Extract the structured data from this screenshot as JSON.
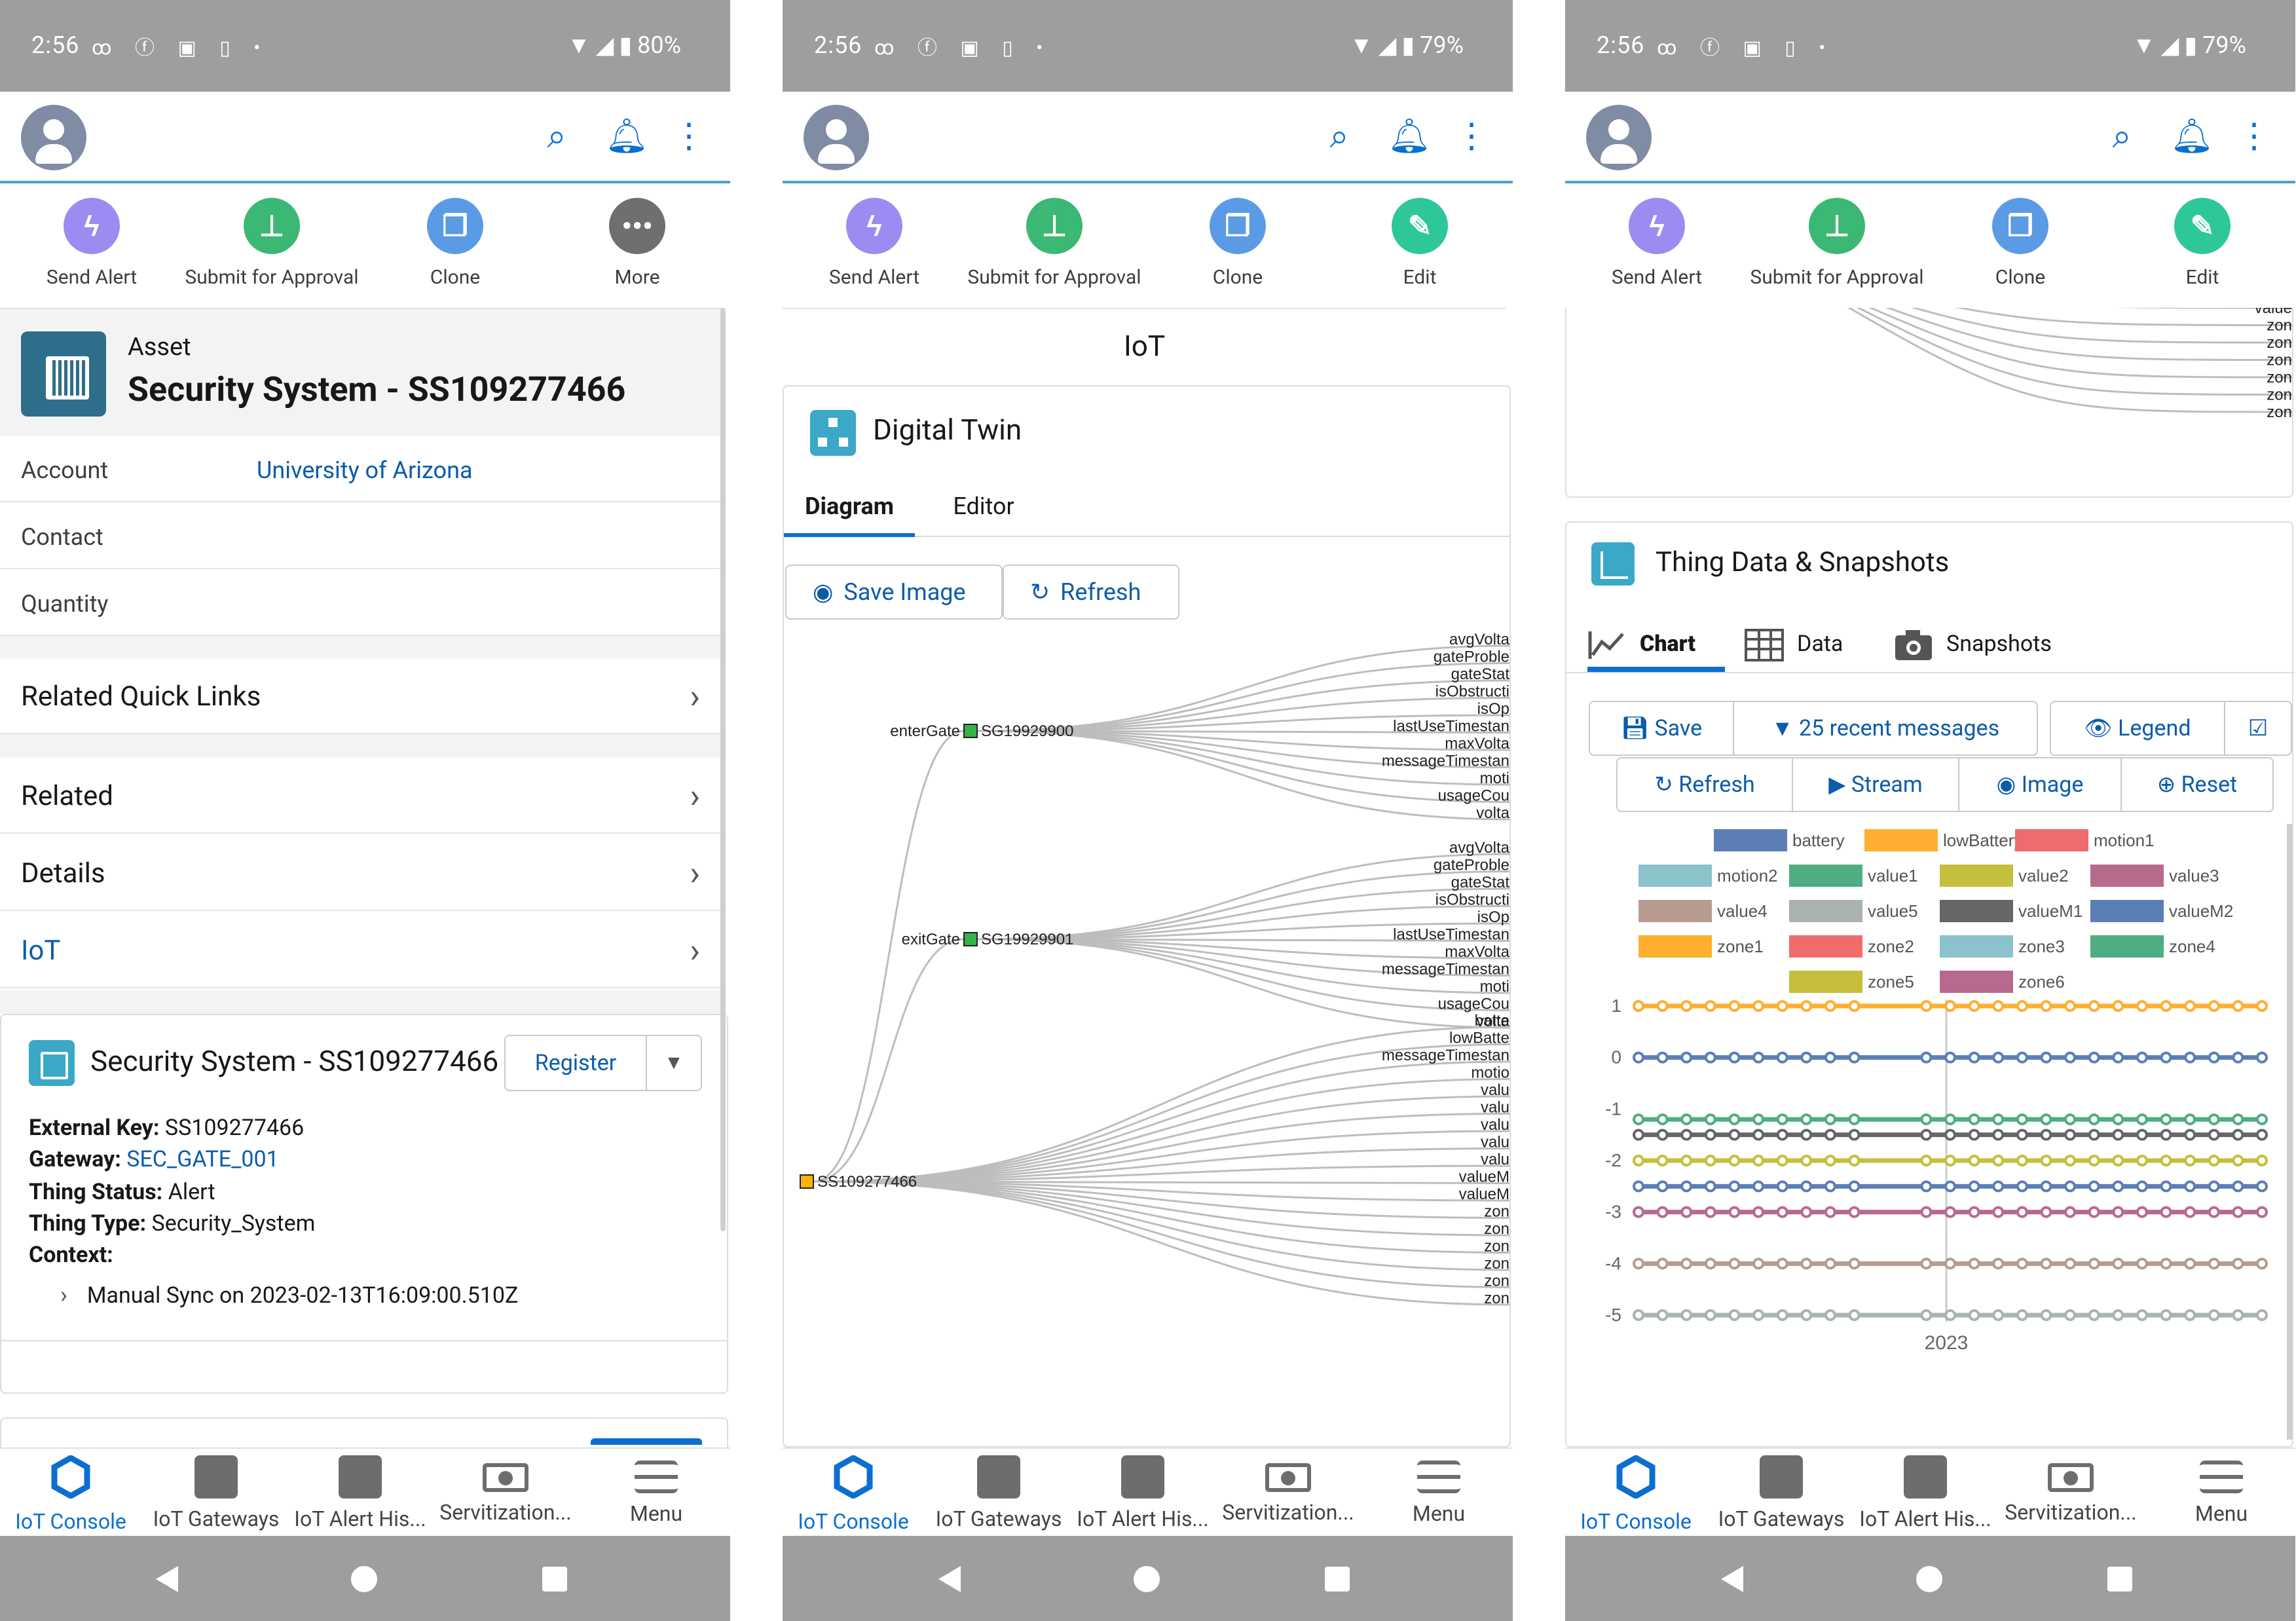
{
  "statusbar": [
    {
      "time": "2:56",
      "battery": "80%"
    },
    {
      "time": "2:56",
      "battery": "79%"
    },
    {
      "time": "2:56",
      "battery": "79%"
    }
  ],
  "actions_s1": [
    "Send Alert",
    "Submit for Approval",
    "Clone",
    "More"
  ],
  "actions_s2": [
    "Send Alert",
    "Submit for Approval",
    "Clone",
    "Edit"
  ],
  "actions_s3": [
    "Send Alert",
    "Submit for Approval",
    "Clone",
    "Edit"
  ],
  "asset": {
    "type_label": "Asset",
    "name": "Security System - SS109277466",
    "fields": [
      {
        "label": "Account",
        "value": "University of Arizona"
      },
      {
        "label": "Contact",
        "value": ""
      },
      {
        "label": "Quantity",
        "value": ""
      }
    ],
    "nav": [
      "Related Quick Links",
      "Related",
      "Details",
      "IoT"
    ]
  },
  "iot_card": {
    "title": "Security System - SS109277466",
    "register_label": "Register",
    "external_key_label": "External Key:",
    "external_key": "SS109277466",
    "gateway_label": "Gateway:",
    "gateway": "SEC_GATE_001",
    "thing_status_label": "Thing Status:",
    "thing_status": "Alert",
    "thing_type_label": "Thing Type:",
    "thing_type": "Security_System",
    "context_label": "Context:",
    "context_item": "Manual Sync on 2023-02-13T16:09:00.510Z"
  },
  "digital_twin": {
    "section_title": "IoT",
    "title": "Digital Twin",
    "tabs": [
      "Diagram",
      "Editor"
    ],
    "save_image": "Save Image",
    "refresh": "Refresh",
    "root": "SS109277466",
    "gates": [
      {
        "label": "enterGate",
        "id": "SG19929900"
      },
      {
        "label": "exitGate",
        "id": "SG19929901"
      }
    ],
    "gate_leaves": [
      "avgVolta",
      "gateProble",
      "gateStat",
      "isObstructi",
      "isOp",
      "lastUseTimestan",
      "maxVolta",
      "messageTimestan",
      "moti",
      "usageCou",
      "volta"
    ],
    "root_leaves": [
      "batte",
      "lowBatte",
      "messageTimestan",
      "motio",
      "valu",
      "valu",
      "valu",
      "valu",
      "valu",
      "valueM",
      "valueM",
      "zon",
      "zon",
      "zon",
      "zon",
      "zon",
      "zon"
    ]
  },
  "thing_data": {
    "partial_leaves": [
      "value",
      "zon",
      "zon",
      "zon",
      "zon",
      "zon",
      "zon"
    ],
    "title": "Thing Data & Snapshots",
    "tabs": [
      "Chart",
      "Data",
      "Snapshots"
    ],
    "buttons_row1": [
      "Save",
      "25 recent messages",
      "Legend",
      "☑"
    ],
    "buttons_row2": [
      "Refresh",
      "Stream",
      "Image",
      "Reset"
    ]
  },
  "bottom_nav": [
    "IoT Console",
    "IoT Gateways",
    "IoT Alert His...",
    "Servitization...",
    "Menu"
  ],
  "colors": {
    "brand": "#0b6fd1",
    "link": "#0b5cab",
    "accent_line": "#4aa1c8",
    "status_bar": "#9e9e9e"
  },
  "chart_data": {
    "type": "line",
    "title": "",
    "xlabel": "2023",
    "ylabel": "",
    "ylim": [
      -5,
      1
    ],
    "yticks": [
      1,
      0,
      -1,
      -2,
      -3,
      -4,
      -5
    ],
    "legend_position": "top",
    "series": [
      {
        "name": "battery",
        "color": "#5b7fb5",
        "values": []
      },
      {
        "name": "lowBattery",
        "color": "#ffae2f",
        "values": [
          1
        ]
      },
      {
        "name": "motion1",
        "color": "#ef6c6c",
        "values": []
      },
      {
        "name": "motion2",
        "color": "#8bc2cb",
        "values": []
      },
      {
        "name": "value1",
        "color": "#4fad82",
        "values": [
          -1.2
        ]
      },
      {
        "name": "value2",
        "color": "#c5bf3d",
        "values": [
          -2
        ]
      },
      {
        "name": "value3",
        "color": "#b86a8e",
        "values": [
          -3
        ]
      },
      {
        "name": "value4",
        "color": "#b79a90",
        "values": [
          -4
        ]
      },
      {
        "name": "value5",
        "color": "#aab3ad",
        "values": [
          -5
        ]
      },
      {
        "name": "valueM1",
        "color": "#666666",
        "values": [
          -1.5
        ]
      },
      {
        "name": "valueM2",
        "color": "#5b7fb5",
        "values": [
          0,
          -2.5
        ]
      },
      {
        "name": "zone1",
        "color": "#ffae2f",
        "values": []
      },
      {
        "name": "zone2",
        "color": "#ef6c6c",
        "values": []
      },
      {
        "name": "zone3",
        "color": "#8bc2cb",
        "values": []
      },
      {
        "name": "zone4",
        "color": "#4fad82",
        "values": []
      },
      {
        "name": "zone5",
        "color": "#c5bf3d",
        "values": []
      },
      {
        "name": "zone6",
        "color": "#b86a8e",
        "values": []
      }
    ]
  }
}
